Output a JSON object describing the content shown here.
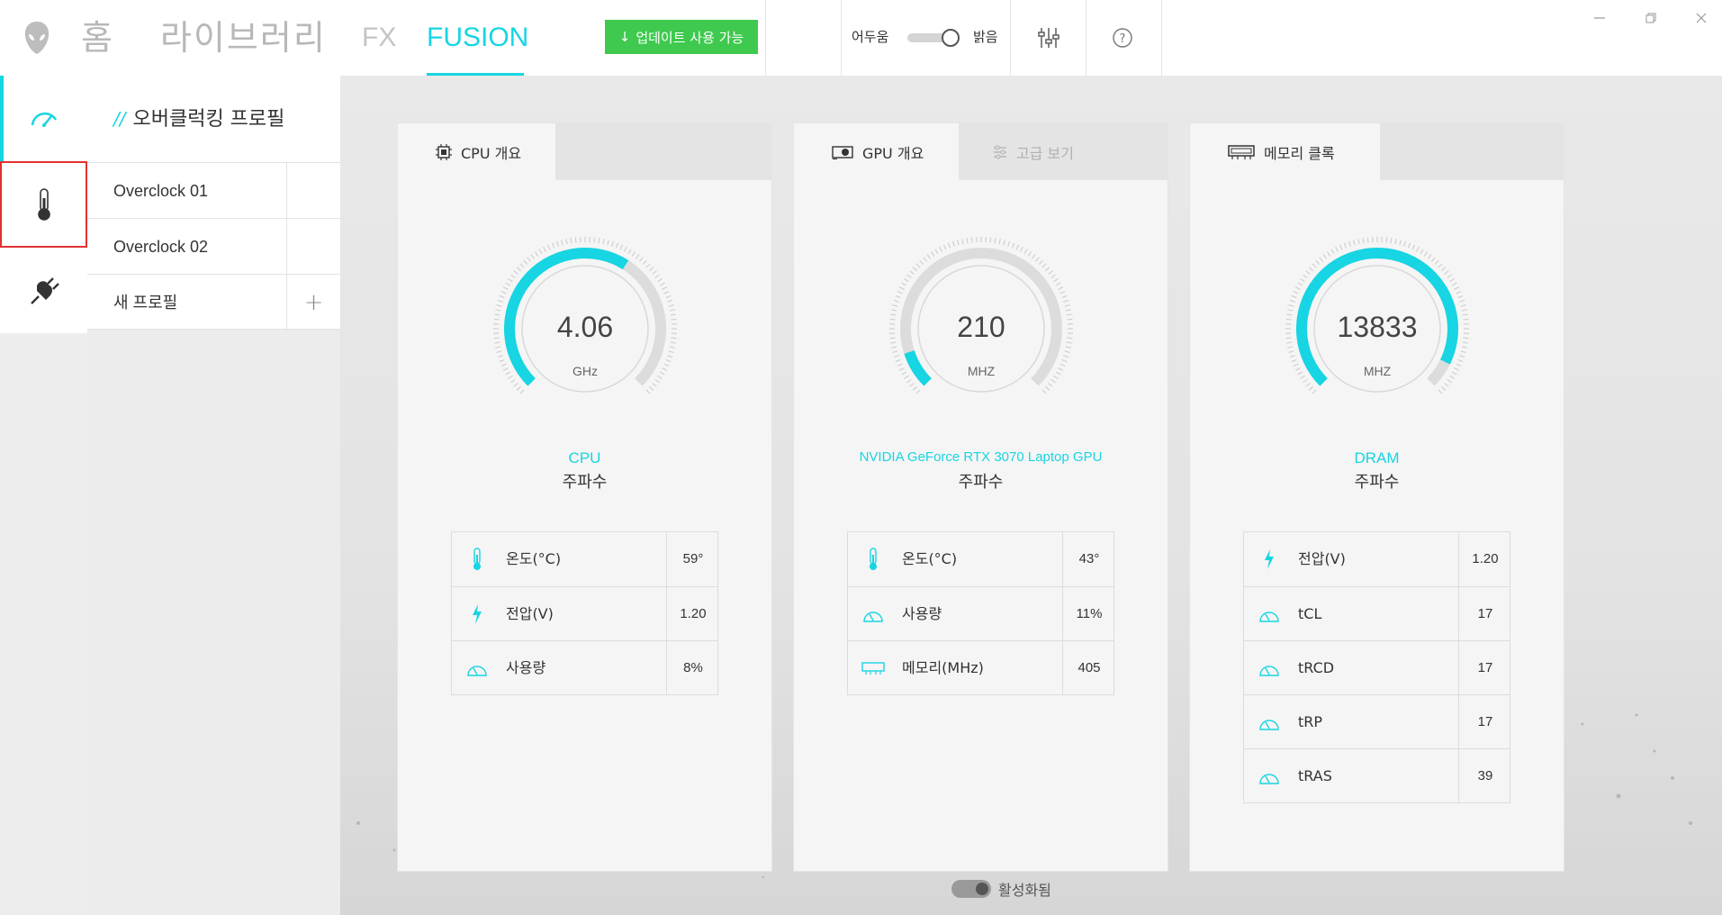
{
  "nav": {
    "home": "홈",
    "library": "라이브러리",
    "fx": "FX",
    "fusion": "FUSION",
    "update_button": "업데이트 사용 가능"
  },
  "theme": {
    "dark_label": "어두움",
    "light_label": "밝음",
    "selected": "밝음"
  },
  "profiles": {
    "title": "오버클럭킹 프로필",
    "items": [
      {
        "name": "Overclock 01",
        "active": true
      },
      {
        "name": "Overclock 02",
        "active": false
      }
    ],
    "new_profile": "새 프로필"
  },
  "cards": {
    "cpu": {
      "tab": "CPU 개요",
      "gauge_value": "4.06",
      "gauge_unit": "GHz",
      "gauge_fill": 0.62,
      "device": "CPU",
      "metric": "주파수",
      "stats": [
        {
          "icon": "thermometer-icon",
          "label": "온도(°C)",
          "value": "59°"
        },
        {
          "icon": "lightning-icon",
          "label": "전압(V)",
          "value": "1.20"
        },
        {
          "icon": "gauge-icon",
          "label": "사용량",
          "value": "8%"
        }
      ]
    },
    "gpu": {
      "tab": "GPU 개요",
      "tab2": "고급 보기",
      "gauge_value": "210",
      "gauge_unit": "MHZ",
      "gauge_fill": 0.1,
      "device": "NVIDIA GeForce RTX 3070 Laptop GPU",
      "metric": "주파수",
      "stats": [
        {
          "icon": "thermometer-icon",
          "label": "온도(°C)",
          "value": "43°"
        },
        {
          "icon": "gauge-icon",
          "label": "사용량",
          "value": "11%"
        },
        {
          "icon": "memory-icon",
          "label": "메모리(MHz)",
          "value": "405"
        }
      ],
      "toggle_label": "활성화됨"
    },
    "memory": {
      "tab": "메모리 클록",
      "gauge_value": "13833",
      "gauge_unit": "MHZ",
      "gauge_fill": 0.93,
      "device": "DRAM",
      "metric": "주파수",
      "stats": [
        {
          "icon": "lightning-icon",
          "label": "전압(V)",
          "value": "1.20"
        },
        {
          "icon": "gauge-icon",
          "label": "tCL",
          "value": "17"
        },
        {
          "icon": "gauge-icon",
          "label": "tRCD",
          "value": "17"
        },
        {
          "icon": "gauge-icon",
          "label": "tRP",
          "value": "17"
        },
        {
          "icon": "gauge-icon",
          "label": "tRAS",
          "value": "39"
        }
      ]
    }
  },
  "colors": {
    "accent": "#17d5e2",
    "update_green": "#3fc94e",
    "selection_red": "#e03131"
  }
}
